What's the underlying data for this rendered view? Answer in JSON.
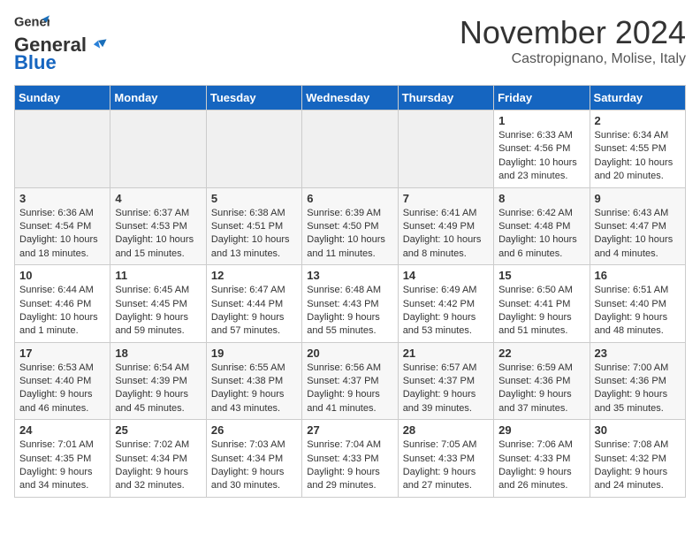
{
  "header": {
    "logo_general": "General",
    "logo_blue": "Blue",
    "month": "November 2024",
    "location": "Castropignano, Molise, Italy"
  },
  "days_of_week": [
    "Sunday",
    "Monday",
    "Tuesday",
    "Wednesday",
    "Thursday",
    "Friday",
    "Saturday"
  ],
  "weeks": [
    [
      {
        "num": "",
        "info": ""
      },
      {
        "num": "",
        "info": ""
      },
      {
        "num": "",
        "info": ""
      },
      {
        "num": "",
        "info": ""
      },
      {
        "num": "",
        "info": ""
      },
      {
        "num": "1",
        "info": "Sunrise: 6:33 AM\nSunset: 4:56 PM\nDaylight: 10 hours and 23 minutes."
      },
      {
        "num": "2",
        "info": "Sunrise: 6:34 AM\nSunset: 4:55 PM\nDaylight: 10 hours and 20 minutes."
      }
    ],
    [
      {
        "num": "3",
        "info": "Sunrise: 6:36 AM\nSunset: 4:54 PM\nDaylight: 10 hours and 18 minutes."
      },
      {
        "num": "4",
        "info": "Sunrise: 6:37 AM\nSunset: 4:53 PM\nDaylight: 10 hours and 15 minutes."
      },
      {
        "num": "5",
        "info": "Sunrise: 6:38 AM\nSunset: 4:51 PM\nDaylight: 10 hours and 13 minutes."
      },
      {
        "num": "6",
        "info": "Sunrise: 6:39 AM\nSunset: 4:50 PM\nDaylight: 10 hours and 11 minutes."
      },
      {
        "num": "7",
        "info": "Sunrise: 6:41 AM\nSunset: 4:49 PM\nDaylight: 10 hours and 8 minutes."
      },
      {
        "num": "8",
        "info": "Sunrise: 6:42 AM\nSunset: 4:48 PM\nDaylight: 10 hours and 6 minutes."
      },
      {
        "num": "9",
        "info": "Sunrise: 6:43 AM\nSunset: 4:47 PM\nDaylight: 10 hours and 4 minutes."
      }
    ],
    [
      {
        "num": "10",
        "info": "Sunrise: 6:44 AM\nSunset: 4:46 PM\nDaylight: 10 hours and 1 minute."
      },
      {
        "num": "11",
        "info": "Sunrise: 6:45 AM\nSunset: 4:45 PM\nDaylight: 9 hours and 59 minutes."
      },
      {
        "num": "12",
        "info": "Sunrise: 6:47 AM\nSunset: 4:44 PM\nDaylight: 9 hours and 57 minutes."
      },
      {
        "num": "13",
        "info": "Sunrise: 6:48 AM\nSunset: 4:43 PM\nDaylight: 9 hours and 55 minutes."
      },
      {
        "num": "14",
        "info": "Sunrise: 6:49 AM\nSunset: 4:42 PM\nDaylight: 9 hours and 53 minutes."
      },
      {
        "num": "15",
        "info": "Sunrise: 6:50 AM\nSunset: 4:41 PM\nDaylight: 9 hours and 51 minutes."
      },
      {
        "num": "16",
        "info": "Sunrise: 6:51 AM\nSunset: 4:40 PM\nDaylight: 9 hours and 48 minutes."
      }
    ],
    [
      {
        "num": "17",
        "info": "Sunrise: 6:53 AM\nSunset: 4:40 PM\nDaylight: 9 hours and 46 minutes."
      },
      {
        "num": "18",
        "info": "Sunrise: 6:54 AM\nSunset: 4:39 PM\nDaylight: 9 hours and 45 minutes."
      },
      {
        "num": "19",
        "info": "Sunrise: 6:55 AM\nSunset: 4:38 PM\nDaylight: 9 hours and 43 minutes."
      },
      {
        "num": "20",
        "info": "Sunrise: 6:56 AM\nSunset: 4:37 PM\nDaylight: 9 hours and 41 minutes."
      },
      {
        "num": "21",
        "info": "Sunrise: 6:57 AM\nSunset: 4:37 PM\nDaylight: 9 hours and 39 minutes."
      },
      {
        "num": "22",
        "info": "Sunrise: 6:59 AM\nSunset: 4:36 PM\nDaylight: 9 hours and 37 minutes."
      },
      {
        "num": "23",
        "info": "Sunrise: 7:00 AM\nSunset: 4:36 PM\nDaylight: 9 hours and 35 minutes."
      }
    ],
    [
      {
        "num": "24",
        "info": "Sunrise: 7:01 AM\nSunset: 4:35 PM\nDaylight: 9 hours and 34 minutes."
      },
      {
        "num": "25",
        "info": "Sunrise: 7:02 AM\nSunset: 4:34 PM\nDaylight: 9 hours and 32 minutes."
      },
      {
        "num": "26",
        "info": "Sunrise: 7:03 AM\nSunset: 4:34 PM\nDaylight: 9 hours and 30 minutes."
      },
      {
        "num": "27",
        "info": "Sunrise: 7:04 AM\nSunset: 4:33 PM\nDaylight: 9 hours and 29 minutes."
      },
      {
        "num": "28",
        "info": "Sunrise: 7:05 AM\nSunset: 4:33 PM\nDaylight: 9 hours and 27 minutes."
      },
      {
        "num": "29",
        "info": "Sunrise: 7:06 AM\nSunset: 4:33 PM\nDaylight: 9 hours and 26 minutes."
      },
      {
        "num": "30",
        "info": "Sunrise: 7:08 AM\nSunset: 4:32 PM\nDaylight: 9 hours and 24 minutes."
      }
    ]
  ]
}
